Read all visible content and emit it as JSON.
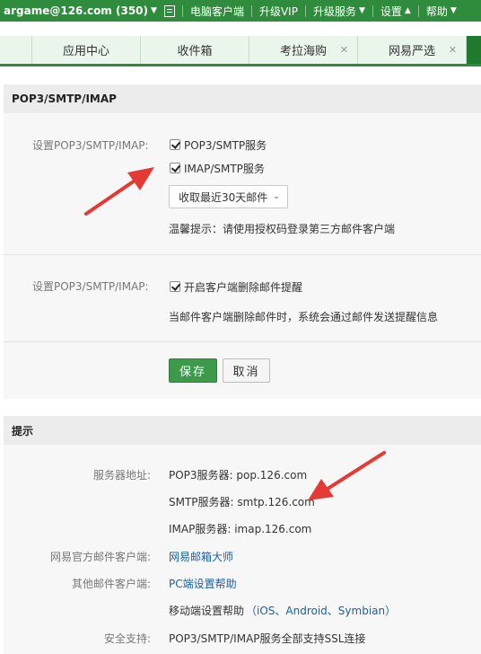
{
  "topbar": {
    "account": "argame@126.com (350)",
    "links": [
      "电脑客户端",
      "升级VIP",
      "升级服务",
      "设置",
      "帮助"
    ]
  },
  "tabs": [
    "应用中心",
    "收件箱",
    "考拉海购",
    "网易严选"
  ],
  "section1": {
    "title": "POP3/SMTP/IMAP",
    "label1": "设置POP3/SMTP/IMAP:",
    "pop3_label": "POP3/SMTP服务",
    "pop3_checked": true,
    "imap_label": "IMAP/SMTP服务",
    "imap_checked": true,
    "fetch_select": "收取最近30天邮件",
    "tip": "温馨提示：请使用授权码登录第三方邮件客户端",
    "label2": "设置POP3/SMTP/IMAP:",
    "delete_notify_label": "开启客户端删除邮件提醒",
    "delete_notify_checked": true,
    "delete_notify_desc": "当邮件客户端删除邮件时，系统会通过邮件发送提醒信息",
    "save": "保存",
    "cancel": "取消"
  },
  "section2": {
    "title": "提示",
    "server_label": "服务器地址:",
    "pop3_server": "POP3服务器: pop.126.com",
    "smtp_server": "SMTP服务器: smtp.126.com",
    "imap_server": "IMAP服务器: imap.126.com",
    "official_label": "网易官方邮件客户端:",
    "official_link": "网易邮箱大师",
    "other_label": "其他邮件客户端:",
    "pc_help_link": "PC端设置帮助",
    "mobile_help_prefix": "移动端设置帮助",
    "mobile_help_links": "（iOS、Android、Symbian）",
    "security_label": "安全支持:",
    "security_text": "POP3/SMTP/IMAP服务全部支持SSL连接"
  },
  "colors": {
    "brand_green": "#2f8c3c",
    "arrow_red": "#e53935",
    "link_blue": "#1a5fa8"
  }
}
